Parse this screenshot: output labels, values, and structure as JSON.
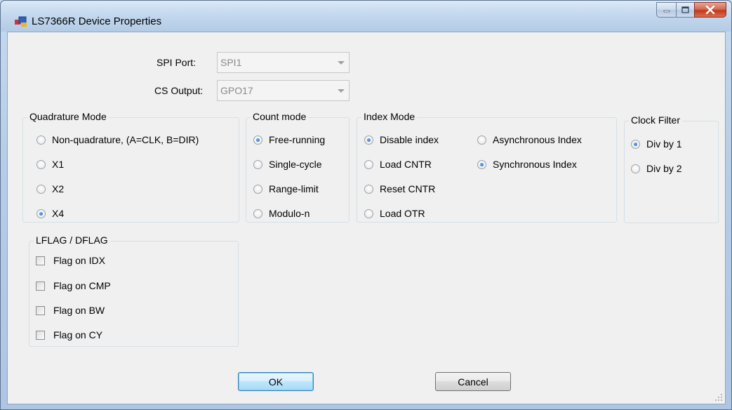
{
  "window": {
    "title": "LS7366R Device Properties"
  },
  "spi": {
    "port_label": "SPI Port:",
    "port_value": "SPI1",
    "cs_label": "CS Output:",
    "cs_value": "GPO17"
  },
  "quadrature": {
    "title": "Quadrature Mode",
    "options": [
      "Non-quadrature, (A=CLK, B=DIR)",
      "X1",
      "X2",
      "X4"
    ],
    "selected": 3
  },
  "count": {
    "title": "Count mode",
    "options": [
      "Free-running",
      "Single-cycle",
      "Range-limit",
      "Modulo-n"
    ],
    "selected": 0
  },
  "index": {
    "title": "Index Mode",
    "options": [
      "Disable index",
      "Load CNTR",
      "Reset CNTR",
      "Load OTR",
      "Asynchronous Index",
      "Synchronous Index"
    ],
    "selected": [
      0,
      5
    ]
  },
  "clock": {
    "title": "Clock Filter",
    "options": [
      "Div by 1",
      "Div by 2"
    ],
    "selected": 0
  },
  "flags": {
    "title": "LFLAG / DFLAG",
    "options": [
      "Flag on IDX",
      "Flag on CMP",
      "Flag on BW",
      "Flag on CY"
    ],
    "checked": [
      false,
      false,
      false,
      false
    ]
  },
  "buttons": {
    "ok": "OK",
    "cancel": "Cancel"
  },
  "colors": {
    "accent": "#1f5fb0",
    "close_button": "#c0391f",
    "titlebar": "#c4d8ee"
  }
}
